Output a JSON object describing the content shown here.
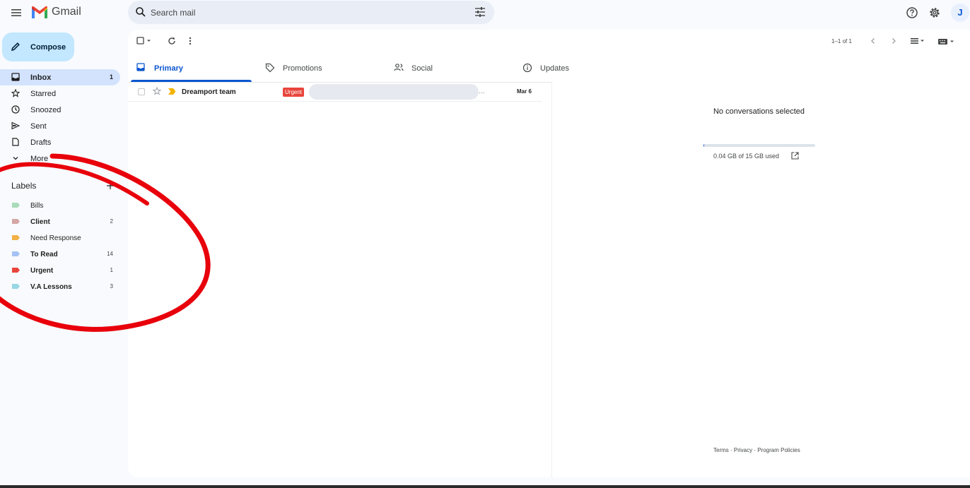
{
  "header": {
    "app_name": "Gmail",
    "search_placeholder": "Search mail",
    "avatar_initial": "J"
  },
  "sidebar": {
    "compose_label": "Compose",
    "items": [
      {
        "label": "Inbox",
        "count": "1",
        "icon": "inbox-icon",
        "active": true
      },
      {
        "label": "Starred",
        "count": "",
        "icon": "star-icon"
      },
      {
        "label": "Snoozed",
        "count": "",
        "icon": "clock-icon"
      },
      {
        "label": "Sent",
        "count": "",
        "icon": "send-icon"
      },
      {
        "label": "Drafts",
        "count": "",
        "icon": "draft-icon"
      },
      {
        "label": "More",
        "count": "",
        "icon": "chevron-down-icon"
      }
    ],
    "labels_heading": "Labels",
    "labels": [
      {
        "name": "Bills",
        "count": "",
        "color": "#a8dbb9",
        "bold": false
      },
      {
        "name": "Client",
        "count": "2",
        "color": "#d5a6a6",
        "bold": true
      },
      {
        "name": "Need Response",
        "count": "",
        "color": "#f2b046",
        "bold": false
      },
      {
        "name": "To Read",
        "count": "14",
        "color": "#a4c2f4",
        "bold": true
      },
      {
        "name": "Urgent",
        "count": "1",
        "color": "#e8453c",
        "bold": true
      },
      {
        "name": "V.A Lessons",
        "count": "3",
        "color": "#98d7e4",
        "bold": true
      }
    ]
  },
  "toolbar": {
    "pagination": "1–1 of 1"
  },
  "tabs": [
    {
      "label": "Primary",
      "icon": "inbox-icon",
      "active": true
    },
    {
      "label": "Promotions",
      "icon": "tag-icon"
    },
    {
      "label": "Social",
      "icon": "people-icon"
    },
    {
      "label": "Updates",
      "icon": "info-icon"
    }
  ],
  "emails": [
    {
      "sender": "Dreamport team",
      "label": "Urgent",
      "snippet": "",
      "date": "Mar 6",
      "label_color": "#e8453c"
    }
  ],
  "reading_pane": {
    "empty_message": "No conversations selected",
    "storage_text": "0.04 GB of 15 GB used",
    "storage_used_fraction": 0.003,
    "footer": "Terms · Privacy · Program Policies"
  },
  "colors": {
    "accent": "#0b57d0",
    "compose_bg": "#c2e7ff",
    "annotation": "#e8000b"
  }
}
